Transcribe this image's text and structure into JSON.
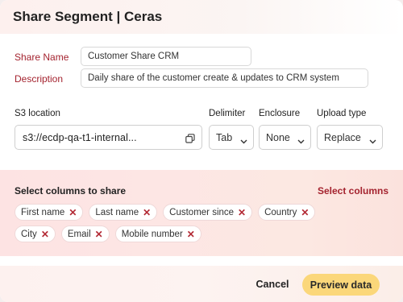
{
  "dialog": {
    "title": "Share Segment | Ceras"
  },
  "form": {
    "share_name_label": "Share Name",
    "share_name_value": "Customer Share CRM",
    "description_label": "Description",
    "description_value": "Daily share of the customer create & updates to CRM system",
    "s3_label": "S3 location",
    "s3_value": "s3://ecdp-qa-t1-internal...",
    "delimiter_label": "Delimiter",
    "delimiter_value": "Tab",
    "enclosure_label": "Enclosure",
    "enclosure_value": "None",
    "upload_type_label": "Upload type",
    "upload_type_value": "Replace"
  },
  "columns": {
    "title": "Select columns to share",
    "select_link": "Select columns",
    "chips": [
      "First name",
      "Last name",
      "Customer since",
      "Country",
      "City",
      "Email",
      "Mobile number"
    ],
    "remove_glyph": "✕"
  },
  "footer": {
    "cancel_label": "Cancel",
    "preview_label": "Preview data"
  },
  "icons": {
    "copy": "copy-icon",
    "chevron": "chevron-down-icon"
  },
  "colors": {
    "accent_red": "#a4232f",
    "primary_button": "#fbd77a"
  }
}
